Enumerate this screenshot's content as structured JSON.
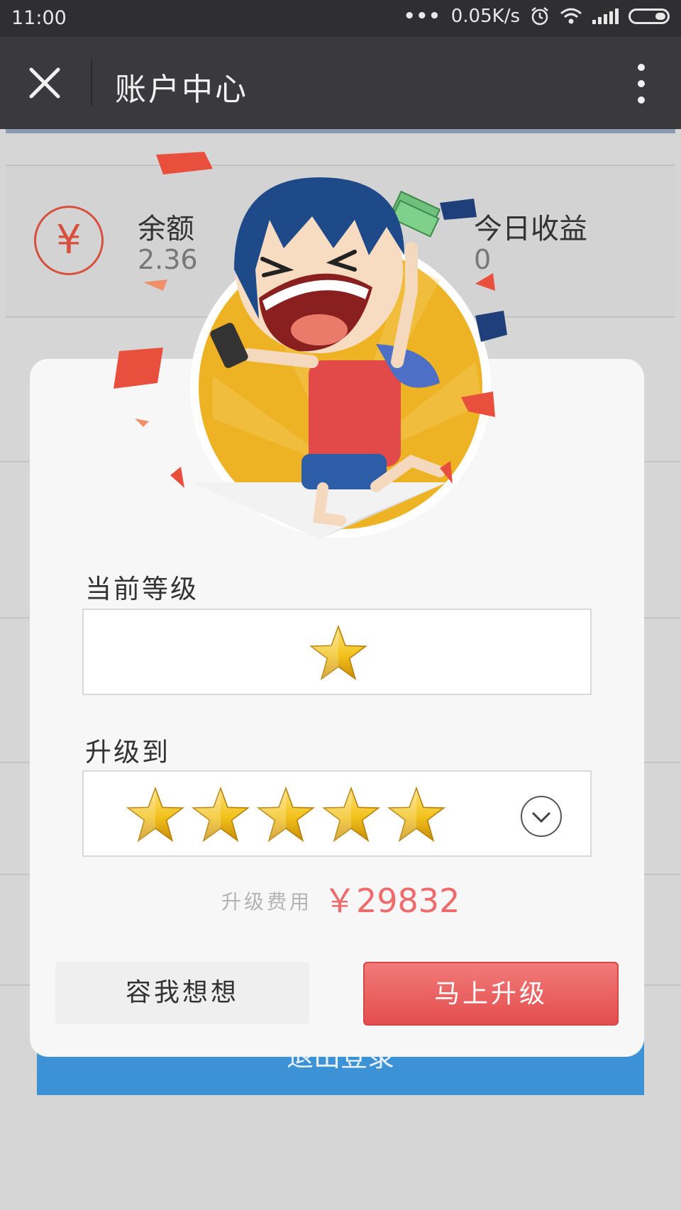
{
  "status_bar": {
    "time": "11:00",
    "dots": "•••",
    "network_speed": "0.05K/s"
  },
  "header": {
    "title": "账户中心"
  },
  "background": {
    "balance_label": "余额",
    "balance_value": "2.36",
    "today_earnings_label": "今日收益",
    "today_earnings_value": "0",
    "currency_symbol": "¥",
    "logout_label": "退出登录"
  },
  "modal": {
    "current_level_label": "当前等级",
    "current_level_stars": 1,
    "upgrade_to_label": "升级到",
    "upgrade_to_stars": 5,
    "fee_label": "升级费用",
    "fee_value": "￥29832",
    "later_button": "容我想想",
    "upgrade_button": "马上升级"
  },
  "colors": {
    "accent": "#e85353",
    "star_gold": "#f2c21b",
    "illustration_yellow": "#edb324",
    "logout_blue": "#3d92d6"
  },
  "icons": [
    "close-icon",
    "more-vert-icon",
    "yen-icon",
    "star-icon",
    "chevron-down-icon",
    "wifi-icon",
    "signal-icon",
    "battery-icon",
    "alarm-icon"
  ]
}
